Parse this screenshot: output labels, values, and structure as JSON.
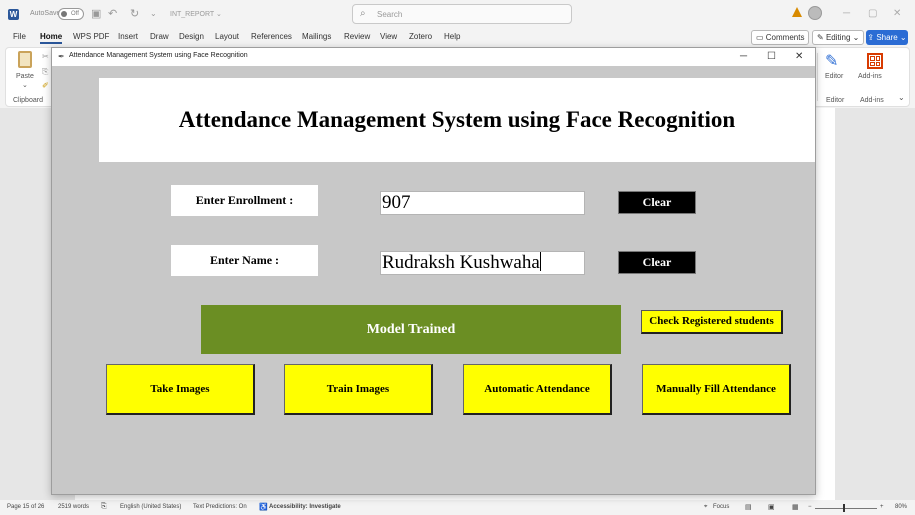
{
  "word": {
    "app_icon": "word-icon",
    "autosave_label": "AutoSave",
    "autosave_state": "Off",
    "doc_name": "INT_REPORT ⌄",
    "search_placeholder": "Search",
    "menu": [
      "File",
      "Home",
      "WPS PDF",
      "Insert",
      "Draw",
      "Design",
      "Layout",
      "References",
      "Mailings",
      "Review",
      "View",
      "Zotero",
      "Help"
    ],
    "active_menu": "Home",
    "comments_label": "Comments",
    "editing_label": "Editing ⌄",
    "share_label": "Share ⌄",
    "ribbon": {
      "paste_label": "Paste",
      "clipboard_label": "Clipboard",
      "editor_label": "Editor",
      "addins_label": "Add-ins",
      "editor_group_label": "Editor",
      "addins_group_label": "Add-ins"
    },
    "status": {
      "page": "Page 15 of 26",
      "words": "2519 words",
      "language": "English (United States)",
      "predictions": "Text Predictions: On",
      "accessibility": "Accessibility: Investigate",
      "focus": "Focus",
      "zoom": "80%"
    }
  },
  "app": {
    "window_title": "Attendance Management System using Face Recognition",
    "heading": "Attendance Management System using Face Recognition",
    "enrollment_label": "Enter Enrollment :",
    "enrollment_value": "907",
    "name_label": "Enter Name :",
    "name_value": "Rudraksh Kushwaha",
    "clear_label": "Clear",
    "status_message": "Model Trained",
    "check_registered_label": "Check Registered students",
    "buttons": {
      "take_images": "Take Images",
      "train_images": "Train Images",
      "automatic_attendance": "Automatic Attendance",
      "manual_attendance": "Manually Fill Attendance"
    },
    "colors": {
      "window_bg": "#c8c8c8",
      "status_bg": "#6b8e23",
      "button_bg": "#ffff00",
      "clear_bg": "#000000"
    }
  }
}
